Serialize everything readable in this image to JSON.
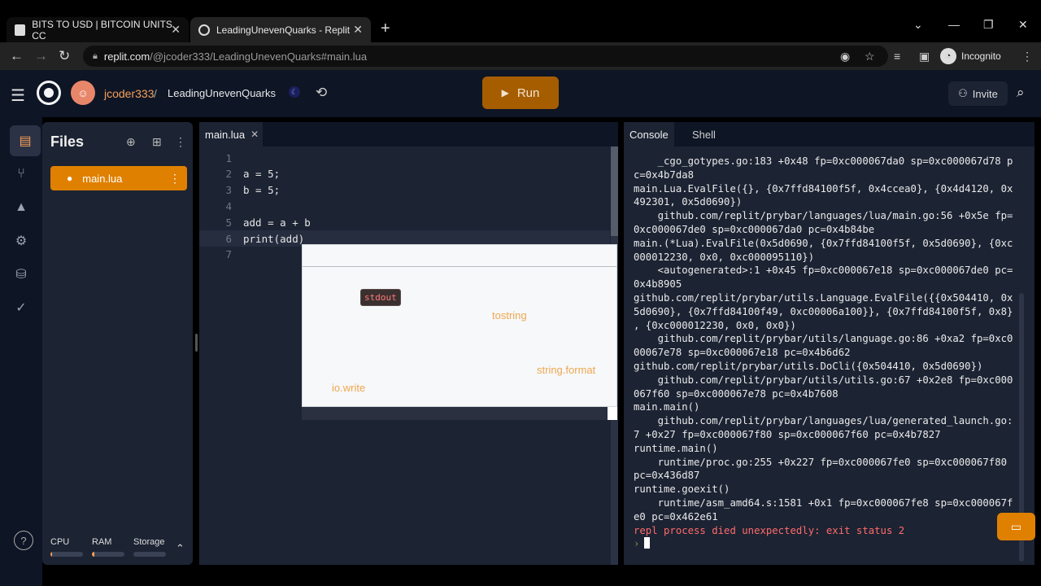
{
  "browser": {
    "tabs": [
      {
        "title": "BITS TO USD | BITCOIN UNITS CC"
      },
      {
        "title": "LeadingUnevenQuarks - Replit"
      }
    ],
    "new_tab": "+",
    "close_glyph": "✕",
    "url_host": "replit.com",
    "url_path": "/@jcoder333/LeadingUnevenQuarks#main.lua",
    "incognito_label": "Incognito"
  },
  "header": {
    "username": "jcoder333",
    "separator": "/",
    "project": "LeadingUnevenQuarks",
    "run_label": "Run",
    "invite_label": "Invite"
  },
  "files": {
    "title": "Files",
    "items": [
      {
        "name": "main.lua"
      }
    ],
    "meters": [
      {
        "label": "CPU",
        "level": 0.05
      },
      {
        "label": "RAM",
        "level": 0.08
      },
      {
        "label": "Storage",
        "level": 0.0
      }
    ]
  },
  "editor": {
    "tab": "main.lua",
    "lines": [
      {
        "n": "1",
        "text": ""
      },
      {
        "n": "2",
        "text": "a = 5;"
      },
      {
        "n": "3",
        "text": "b = 5;"
      },
      {
        "n": "4",
        "text": ""
      },
      {
        "n": "5",
        "text": "add = a + b"
      },
      {
        "n": "6",
        "text": "print(add)"
      },
      {
        "n": "7",
        "text": ""
      }
    ],
    "suggestions": [
      "stdout",
      "tostring",
      "string.format",
      "io.write"
    ]
  },
  "console": {
    "tabs": [
      "Console",
      "Shell"
    ],
    "lines": [
      "    _cgo_gotypes.go:183 +0x48 fp=0xc000067da0 sp=0xc000067d78 p",
      "c=0x4b7da8",
      "main.Lua.EvalFile({}, {0x7ffd84100f5f, 0x4ccea0}, {0x4d4120, 0x",
      "492301, 0x5d0690})",
      "    github.com/replit/prybar/languages/lua/main.go:56 +0x5e fp=",
      "0xc000067de0 sp=0xc000067da0 pc=0x4b84be",
      "main.(*Lua).EvalFile(0x5d0690, {0x7ffd84100f5f, 0x5d0690}, {0xc",
      "000012230, 0x0, 0xc000095110})",
      "    <autogenerated>:1 +0x45 fp=0xc000067e18 sp=0xc000067de0 pc=",
      "0x4b8905",
      "github.com/replit/prybar/utils.Language.EvalFile({{0x504410, 0x",
      "5d0690}, {0x7ffd84100f49, 0xc00006a100}}, {0x7ffd84100f5f, 0x8}",
      ", {0xc000012230, 0x0, 0x0})",
      "    github.com/replit/prybar/utils/language.go:86 +0xa2 fp=0xc0",
      "00067e78 sp=0xc000067e18 pc=0x4b6d62",
      "github.com/replit/prybar/utils.DoCli({0x504410, 0x5d0690})",
      "    github.com/replit/prybar/utils/utils.go:67 +0x2e8 fp=0xc000",
      "067f60 sp=0xc000067e78 pc=0x4b7608",
      "main.main()",
      "    github.com/replit/prybar/languages/lua/generated_launch.go:",
      "7 +0x27 fp=0xc000067f80 sp=0xc000067f60 pc=0x4b7827",
      "runtime.main()",
      "    runtime/proc.go:255 +0x227 fp=0xc000067fe0 sp=0xc000067f80",
      "pc=0x436d87",
      "runtime.goexit()",
      "    runtime/asm_amd64.s:1581 +0x1 fp=0xc000067fe8 sp=0xc000067f",
      "e0 pc=0x462e61"
    ],
    "error": "repl process died unexpectedly: exit status 2",
    "prompt": "›"
  },
  "icons": {
    "menu": "☰",
    "history": "⟲",
    "search": "⌕",
    "play": "▶",
    "kebab": "⋮",
    "help": "?",
    "chevron_up": "⌃"
  },
  "colors": {
    "accent": "#f5a05a",
    "run_button": "#a55d00",
    "file_selected": "#e08000",
    "error": "#ff6b6b"
  }
}
